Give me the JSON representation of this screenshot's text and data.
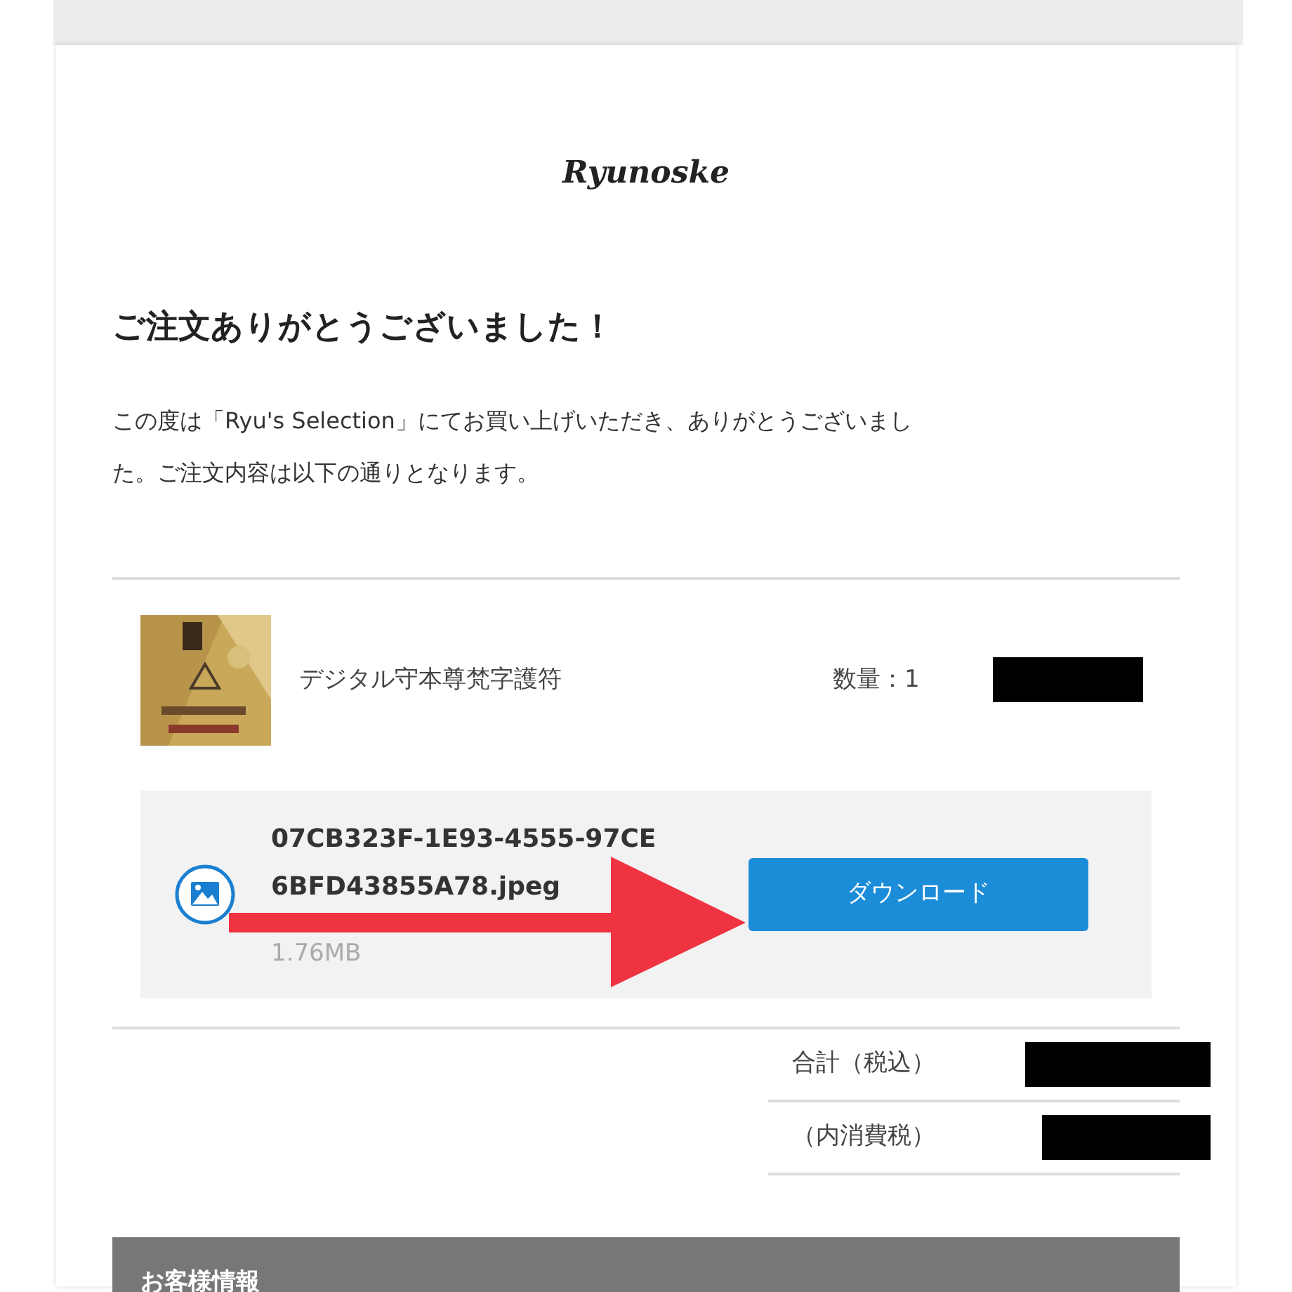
{
  "logo": "Ryunoske",
  "heading": "ご注文ありがとうございました！",
  "message": "この度は「Ryu's Selection」にてお買い上げいただき、ありがとうございました。ご注文内容は以下の通りとなります。",
  "items": [
    {
      "name": "デジタル守本尊梵字護符",
      "quantity": "数量：1"
    }
  ],
  "download": {
    "filename_lines": [
      "07CB323F-1E93-4555-97CE",
      "6BFD43855A78.jpeg"
    ],
    "size": "1.76MB",
    "button": "ダウンロード"
  },
  "totals": [
    {
      "label": "合計（税込）"
    },
    {
      "label": "（内消費税）"
    }
  ],
  "section_header": "お客様情報"
}
